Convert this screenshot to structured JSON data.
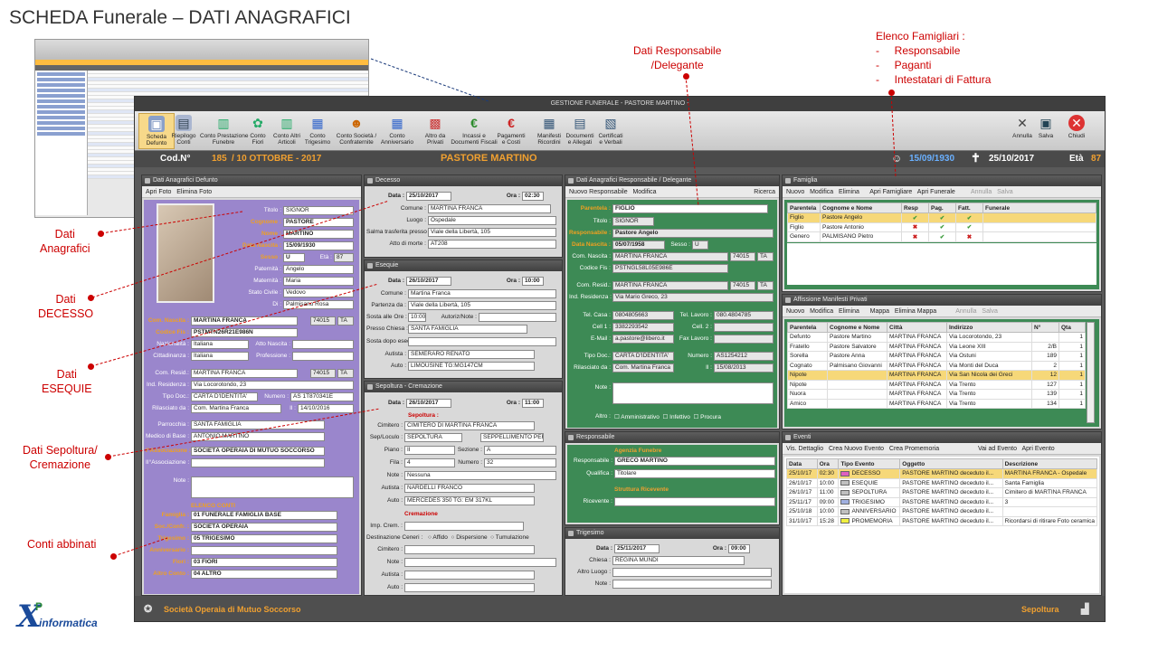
{
  "title": "SCHEDA Funerale – DATI ANAGRAFICI",
  "annotations": {
    "dati_resp": "Dati Responsabile\n/Delegante",
    "elenco": [
      "Elenco Famigliari :",
      "-     Responsabile",
      "-     Paganti",
      "-     Intestatari di Fattura"
    ],
    "anagrafici": "Dati\nAnagrafici",
    "decesso": "Dati\nDECESSO",
    "esequie": "Dati\nESEQUIE",
    "sepoltura": "Dati Sepoltura/\nCremazione",
    "conti": "Conti abbinati"
  },
  "logo": {
    "brand": "informatica",
    "mark": "XP"
  },
  "window": {
    "title": "GESTIONE FUNERALE - PASTORE MARTINO -"
  },
  "toolbar": [
    {
      "label": "Scheda\nDefunto",
      "icon": "person-card-icon"
    },
    {
      "label": "Riepilogo\nConti",
      "icon": "summary-icon"
    },
    {
      "label": "Conto Prestazione\nFunebre",
      "icon": "document-icon"
    },
    {
      "label": "Conto\nFiori",
      "icon": "flower-icon"
    },
    {
      "label": "Conto Altri\nArticoli",
      "icon": "document-icon"
    },
    {
      "label": "Conto\nTrigesimo",
      "icon": "calendar-icon"
    },
    {
      "label": "Conto Società /\nConfraternite",
      "icon": "people-icon"
    },
    {
      "label": "Conto\nAnniversario",
      "icon": "calendar-icon"
    },
    {
      "label": "Altro da\nPrivati",
      "icon": "gift-icon"
    },
    {
      "label": "Incassi e\nDocumenti Fiscali",
      "icon": "euro-green-icon"
    },
    {
      "label": "Pagamenti\ne Costi",
      "icon": "euro-red-icon"
    },
    {
      "label": "Manifesti\nRicordini",
      "icon": "poster-icon"
    },
    {
      "label": "Documenti\ne Allegati",
      "icon": "attachment-icon"
    },
    {
      "label": "Certificati\ne Verbali",
      "icon": "certificate-icon"
    },
    {
      "label": "Annulla",
      "icon": "cancel-icon"
    },
    {
      "label": "Salva",
      "icon": "save-icon"
    },
    {
      "label": "Chiudi",
      "icon": "close-icon"
    }
  ],
  "info": {
    "cod_label": "Cod.N°",
    "cod": "185",
    "date": "/ 10 OTTOBRE - 2017",
    "name": "PASTORE MARTINO",
    "birth": "15/09/1930",
    "death": "25/10/2017",
    "age_label": "Età",
    "age": "87"
  },
  "defunto": {
    "header": "Dati Anagrafici Defunto",
    "apri_foto": "Apri Foto",
    "elimina_foto": "Elimina Foto",
    "fields": [
      {
        "l": "Titolo :",
        "v": "SIGNOR"
      },
      {
        "l": "Cognome :",
        "v": "PASTORE"
      },
      {
        "l": "Nome :",
        "v": "MARTINO"
      },
      {
        "l": "Data Nascita :",
        "v": "15/09/1930"
      },
      {
        "l": "Sesso :",
        "v": "U",
        "extra_l": "Età :",
        "extra_v": "87"
      },
      {
        "l": "Paternità :",
        "v": "Angelo"
      },
      {
        "l": "Maternità :",
        "v": "Maria"
      },
      {
        "l": "Stato Civile :",
        "v": "Vedovo"
      },
      {
        "l": "Di :",
        "v": "Palmisano Rosa"
      }
    ],
    "com_nascita_l": "Com. Nascita :",
    "com_nascita": "MARTINA FRANCA",
    "cap1": "74015",
    "prov1": "TA",
    "cf_l": "Codice Fis :",
    "cf": "PSTMTN26R21E986N",
    "naz_l": "Nazionalità :",
    "naz": "Italiana",
    "atto_l": "Atto Nascita :",
    "citt_l": "Cittadinanza :",
    "citt": "Italiana",
    "prof_l": "Professione :",
    "res_l": "Com. Resid.:",
    "res": "MARTINA FRANCA",
    "cap2": "74015",
    "prov2": "TA",
    "ind_l": "Ind. Residenza :",
    "ind": "Via Locorotondo, 23",
    "doc_l": "Tipo Doc.:",
    "doc": "CARTA D'IDENTITA'",
    "num_l": "Numero :",
    "num": "AS 1T870341E",
    "ril_l": "Rilasciato da :",
    "ril": "Com. Martina Franca",
    "il_l": "Il :",
    "il": "14/10/2016",
    "parr_l": "Parrocchia :",
    "parr": "SANTA FAMIGLIA",
    "med_l": "Medico di Base :",
    "med": "ANTONIO MARTINO",
    "ass1_l": "I°Associazione :",
    "ass1": "SOCIETÀ OPERAIA DI MUTUO SOCCORSO",
    "ass2_l": "II°Associazione :",
    "note_l": "Note :",
    "conti_h": "ELENCO CONTI",
    "conti": [
      {
        "l": "Famiglia :",
        "v": "01 FUNERALE FAMIGLIA BASE"
      },
      {
        "l": "Soc./Confr. :",
        "v": "SOCIETÀ OPERAIA"
      },
      {
        "l": "Trigesimo :",
        "v": "05 TRIGESIMO"
      },
      {
        "l": "Anniversario :",
        "v": ""
      },
      {
        "l": "Fiori :",
        "v": "03 FIORI"
      },
      {
        "l": "Altro Conto :",
        "v": "04 ALTRO"
      }
    ]
  },
  "decesso": {
    "header": "Decesso",
    "data_l": "Data :",
    "data": "25/10/2017",
    "ora_l": "Ora :",
    "ora": "02:30",
    "com_l": "Comune :",
    "com": "MARTINA FRANCA",
    "luogo_l": "Luogo :",
    "luogo": "Ospedale",
    "salma_l": "Salma trasferita presso :",
    "salma": "Viale della Libertà, 105",
    "atto_l": "Atto di morte :",
    "atto": "AT208"
  },
  "esequie": {
    "header": "Esequie",
    "data_l": "Data :",
    "data": "26/10/2017",
    "ora_l": "Ora :",
    "ora": "10:00",
    "com_l": "Comune :",
    "com": "Martina Franca",
    "part_l": "Partenza da :",
    "part": "Viale della Libertà, 105",
    "sosta_l": "Sosta alle Ore :",
    "sosta": "10:00",
    "aut_l": "Autoriz/Note :",
    "chiesa_l": "Presso Chiesa :",
    "chiesa": "SANTA FAMIGLIA",
    "dopo_l": "Sosta dopo esequie :",
    "autista_l": "Autista :",
    "autista": "SEMERARO RENATO",
    "auto_l": "Auto :",
    "auto": "LIMOUSINE TG:MG147CM"
  },
  "sepoltura": {
    "header": "Sepoltura - Cremazione",
    "data_l": "Data :",
    "data": "26/10/2017",
    "ora_l": "Ora :",
    "ora": "11:00",
    "sep_t": "Sepoltura :",
    "cim_l": "Cimitero :",
    "cim": "CIMITERO DI MARTINA FRANCA",
    "loc_l": "Sep/Loculo :",
    "loc": "SEPOLTURA",
    "loc2": "SEPPELLIMENTO PERP...",
    "piano_l": "Piano :",
    "piano": "II",
    "sez_l": "Sezione :",
    "sez": "A",
    "fila_l": "Fila :",
    "fila": "4",
    "num_l": "Numero :",
    "num": "32",
    "note_l": "Note :",
    "note": "Nessuna",
    "autista_l": "Autista :",
    "autista": "NARDELLI FRANCO",
    "auto_l": "Auto :",
    "auto": "MERCEDES 350 TG: EM 317KL",
    "crem_t": "Cremazione",
    "imp_l": "Imp. Crem. :",
    "dest_l": "Destinazione Ceneri :",
    "dest": [
      "Affido",
      "Dispersione",
      "Tumulazione"
    ],
    "cim2_l": "Cimitero :",
    "note2_l": "Note :",
    "autista2_l": "Autista :",
    "auto2_l": "Auto :"
  },
  "responsabile": {
    "header": "Dati Anagrafici Responsabile / Delegante",
    "nuovo": "Nuovo Responsabile",
    "modifica": "Modifica",
    "ricerca": "Ricerca",
    "par_l": "Parentela :",
    "par": "FIGLIO",
    "tit_l": "Titolo :",
    "tit": "SIGNOR",
    "resp_l": "Responsabile :",
    "resp": "Pastore Angelo",
    "dn_l": "Data Nascita :",
    "dn": "05/07/1958",
    "sex_l": "Sesso :",
    "sex": "U",
    "cn_l": "Com. Nascita :",
    "cn": "MARTINA FRANCA",
    "cap1": "74015",
    "prov1": "TA",
    "cf_l": "Codice Fis :",
    "cf": "PSTNGL58L05E986E",
    "cr_l": "Com. Resid.:",
    "cr": "MARTINA FRANCA",
    "cap2": "74015",
    "prov2": "TA",
    "ind_l": "Ind. Residenza :",
    "ind": "Via Mario Greco, 23",
    "tc_l": "Tel. Casa :",
    "tc": "0804805663",
    "tl_l": "Tel. Lavoro :",
    "tl": "080.4804785",
    "c1_l": "Cell 1 :",
    "c1": "3382293542",
    "c2_l": "Cell. 2 :",
    "em_l": "E-Mail :",
    "em": "a.pastore@libero.it",
    "fax_l": "Fax Lavoro :",
    "td_l": "Tipo Doc.:",
    "td": "CARTA D'IDENTITA'",
    "nm_l": "Numero :",
    "nm": "AS1254212",
    "ril_l": "Rilasciato da :",
    "ril": "Com. Martina Franca",
    "il_l": "Il :",
    "il": "15/08/2013",
    "note_l": "Note :",
    "altro_l": "Altro :",
    "checks": [
      "Amministrativo",
      "Infettivo",
      "Procura"
    ]
  },
  "agenzia": {
    "header": "Responsabile",
    "t1": "Agenzia Funebre",
    "r_l": "Responsabile :",
    "r": "GRECO MARTINO",
    "q_l": "Qualifica :",
    "q": "Titolare",
    "t2": "Struttura Ricevente",
    "ric_l": "Ricevente :"
  },
  "trigesimo": {
    "header": "Trigesimo",
    "data_l": "Data :",
    "data": "25/11/2017",
    "ora_l": "Ora :",
    "ora": "09:00",
    "chiesa_l": "Chiesa :",
    "chiesa": "REGINA MUNDI",
    "luogo_l": "Altro Luogo :",
    "note_l": "Note :"
  },
  "famiglia": {
    "header": "Famiglia",
    "tools": [
      "Nuovo",
      "Modifica",
      "Elimina",
      "Apri Famigliare",
      "Apri Funerale",
      "Annulla",
      "Salva"
    ],
    "cols": [
      "Parentela",
      "Cognome e Nome",
      "Resp",
      "Pag.",
      "Fatt.",
      "Funerale"
    ],
    "rows": [
      [
        "Figlio",
        "Pastore Angelo",
        "y",
        "y",
        "y",
        ""
      ],
      [
        "Figlio",
        "Pastore Antonio",
        "n",
        "y",
        "y",
        ""
      ],
      [
        "Genero",
        "PALMISANO Pietro",
        "n",
        "y",
        "n",
        ""
      ]
    ]
  },
  "affissione": {
    "header": "Affissione Manifesti Privati",
    "tools": [
      "Nuovo",
      "Modifica",
      "Elimina",
      "Mappa",
      "Elimina Mappa",
      "Annulla",
      "Salva"
    ],
    "cols": [
      "Parentela",
      "Cognome e Nome",
      "Città",
      "Indirizzo",
      "N°",
      "Qta"
    ],
    "rows": [
      [
        "Defunto",
        "Pastore Martino",
        "MARTINA FRANCA",
        "Via Locorotondo, 23",
        "",
        "1"
      ],
      [
        "Fratello",
        "Pastore Salvatore",
        "MARTINA FRANCA",
        "Via Leone XIII",
        "2/B",
        "1"
      ],
      [
        "Sorella",
        "Pastore Anna",
        "MARTINA FRANCA",
        "Via Ostuni",
        "189",
        "1"
      ],
      [
        "Cognato",
        "Palmisano Giovanni",
        "MARTINA FRANCA",
        "Via Monti del Duca",
        "2",
        "1"
      ],
      [
        "Nipote",
        "",
        "MARTINA FRANCA",
        "Via San Nicola dei Greci",
        "12",
        "1"
      ],
      [
        "Nipote",
        "",
        "MARTINA FRANCA",
        "Via Trento",
        "127",
        "1"
      ],
      [
        "Nuora",
        "",
        "MARTINA FRANCA",
        "Via Trento",
        "139",
        "1"
      ],
      [
        "Amico",
        "",
        "MARTINA FRANCA",
        "Via Trento",
        "134",
        "1"
      ]
    ]
  },
  "eventi": {
    "header": "Eventi",
    "tools": [
      "Vis. Dettaglio",
      "Crea Nuovo Evento",
      "Crea Promemoria",
      "Vai ad Evento",
      "Apri Evento"
    ],
    "cols": [
      "Data",
      "Ora",
      "Tipo Evento",
      "Oggetto",
      "Descrizione"
    ],
    "rows": [
      [
        "25/10/17",
        "02:30",
        "DECESSO",
        "PASTORE MARTINO deceduto il...",
        "MARTINA FRANCA - Ospedale",
        "#e060c0"
      ],
      [
        "26/10/17",
        "10:00",
        "ESEQUIE",
        "PASTORE MARTINO deceduto il...",
        "Santa Famiglia",
        "#c0c0c0"
      ],
      [
        "26/10/17",
        "11:00",
        "SEPOLTURA",
        "PASTORE MARTINO deceduto il...",
        "Cimitero di MARTINA FRANCA",
        "#c0c0c0"
      ],
      [
        "25/11/17",
        "09:00",
        "TRIGESIMO",
        "PASTORE MARTINO deceduto il...",
        "3",
        "#a0b0e0"
      ],
      [
        "25/10/18",
        "10:00",
        "ANNIVERSARIO",
        "PASTORE MARTINO deceduto il...",
        "",
        "#c0c0c0"
      ],
      [
        "31/10/17",
        "15:28",
        "PROMEMORIA",
        "PASTORE MARTINO deceduto il...",
        "Ricordarsi di ritirare Foto ceramica",
        "#f0f040"
      ]
    ]
  },
  "status": {
    "left": "Società Operaia di Mutuo Soccorso",
    "right": "Sepoltura"
  }
}
